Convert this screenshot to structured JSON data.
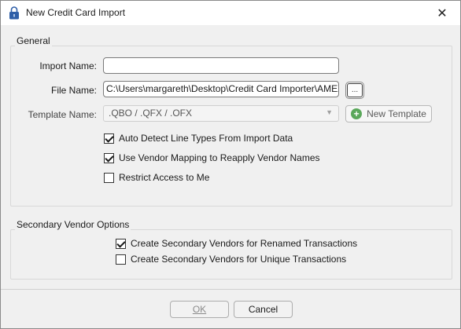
{
  "window": {
    "title": "New Credit Card Import",
    "close_glyph": "✕"
  },
  "general": {
    "group_label": "General",
    "import_name_label": "Import Name:",
    "import_name_value": "",
    "file_name_label": "File Name:",
    "file_name_value": "C:\\Users\\margareth\\Desktop\\Credit Card Importer\\AMEX",
    "browse_label": "...",
    "template_name_label": "Template Name:",
    "template_name_value": ".QBO / .QFX / .OFX",
    "new_template_label": "New Template",
    "checkboxes": [
      {
        "label": "Auto Detect Line Types From Import Data",
        "checked": true
      },
      {
        "label": "Use Vendor Mapping to Reapply Vendor Names",
        "checked": true
      },
      {
        "label": "Restrict Access to Me",
        "checked": false
      }
    ]
  },
  "secondary": {
    "group_label": "Secondary Vendor Options",
    "checkboxes": [
      {
        "label": "Create Secondary Vendors for Renamed Transactions",
        "checked": true
      },
      {
        "label": "Create Secondary Vendors for Unique Transactions",
        "checked": false
      }
    ]
  },
  "footer": {
    "ok_label": "OK",
    "cancel_label": "Cancel"
  },
  "colors": {
    "accent_icon": "#2f5fa8",
    "new_template_plus": "#5aa85a"
  }
}
